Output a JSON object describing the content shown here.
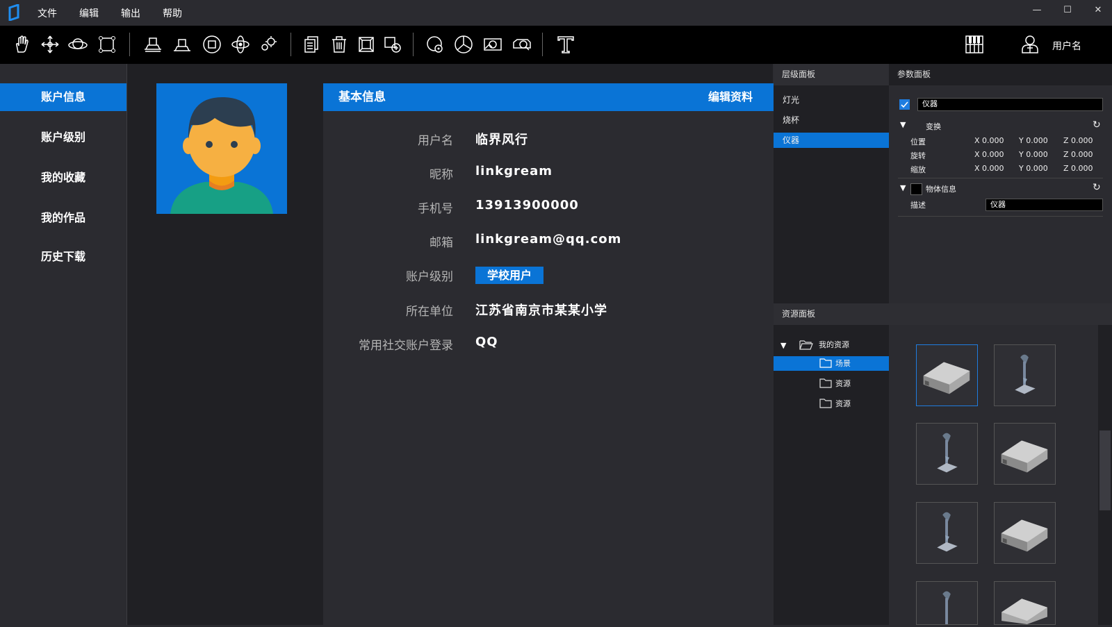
{
  "menu": [
    "文件",
    "编辑",
    "输出",
    "帮助"
  ],
  "window": {
    "minimize": "—",
    "maximize": "☐",
    "close": "✕"
  },
  "toolbar": {
    "user_label": "用户名"
  },
  "sidebar": {
    "items": [
      {
        "label": "账户信息",
        "active": true
      },
      {
        "label": "账户级别",
        "active": false
      },
      {
        "label": "我的收藏",
        "active": false
      },
      {
        "label": "我的作品",
        "active": false
      },
      {
        "label": "历史下载",
        "active": false
      }
    ]
  },
  "info": {
    "title": "基本信息",
    "edit": "编辑资料",
    "fields": [
      {
        "label": "用户名",
        "value": "临界风行"
      },
      {
        "label": "昵称",
        "value": "linkgream"
      },
      {
        "label": "手机号",
        "value": "13913900000"
      },
      {
        "label": "邮箱",
        "value": "linkgream@qq.com"
      },
      {
        "label": "账户级别",
        "value": "学校用户"
      },
      {
        "label": "所在单位",
        "value": "江苏省南京市某某小学"
      },
      {
        "label": "常用社交账户登录",
        "value": "QQ"
      }
    ]
  },
  "hierarchy": {
    "title": "层级面板",
    "items": [
      {
        "label": "灯光",
        "active": false
      },
      {
        "label": "烧杯",
        "active": false
      },
      {
        "label": "仪器",
        "active": true
      }
    ]
  },
  "params": {
    "title": "参数面板",
    "name_value": "仪器",
    "transform_label": "变换",
    "rows": [
      {
        "label": "位置",
        "x": "X 0.000",
        "y": "Y 0.000",
        "z": "Z 0.000"
      },
      {
        "label": "旋转",
        "x": "X 0.000",
        "y": "Y 0.000",
        "z": "Z 0.000"
      },
      {
        "label": "缩放",
        "x": "X 0.000",
        "y": "Y 0.000",
        "z": "Z 0.000"
      }
    ],
    "object_info_label": "物体信息",
    "desc_label": "描述",
    "desc_value": "仪器"
  },
  "resources": {
    "title": "资源面板",
    "root": "我的资源",
    "folders": [
      {
        "label": "场景",
        "active": true
      },
      {
        "label": "资源",
        "active": false
      },
      {
        "label": "资源",
        "active": false
      }
    ]
  },
  "colors": {
    "accent": "#0a74d6",
    "bg": "#2b2b30",
    "toolbar": "#000000"
  }
}
